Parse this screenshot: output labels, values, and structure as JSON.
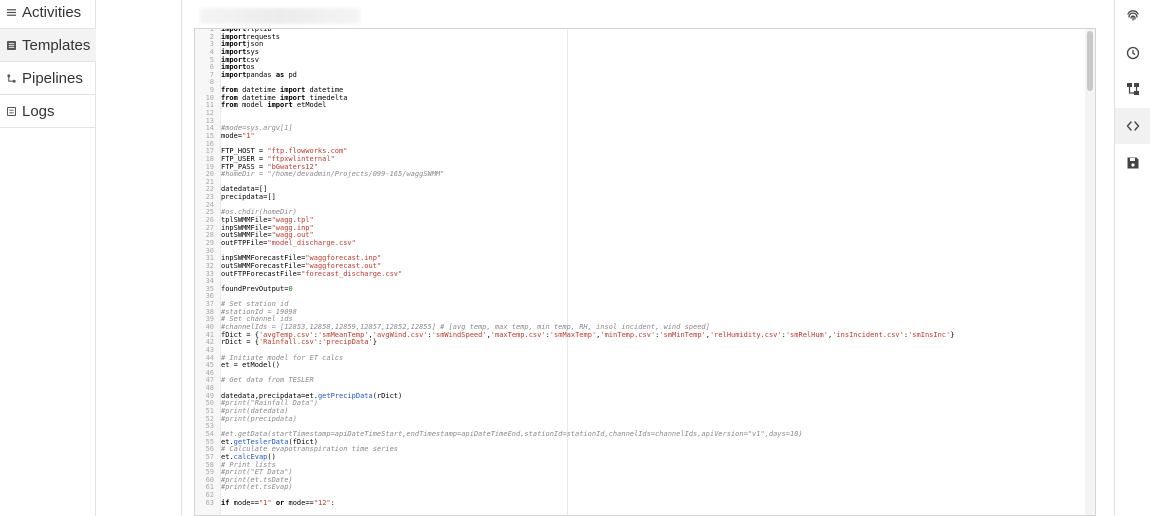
{
  "sidebar": {
    "items": [
      {
        "label": "Activities",
        "icon": "activities-icon"
      },
      {
        "label": "Templates",
        "icon": "templates-icon"
      },
      {
        "label": "Pipelines",
        "icon": "pipelines-icon"
      },
      {
        "label": "Logs",
        "icon": "logs-icon"
      }
    ]
  },
  "toolbar": {
    "tools": [
      "fingerprint-icon",
      "history-icon",
      "hierarchy-icon",
      "code-icon",
      "save-icon"
    ]
  },
  "editor": {
    "lines": [
      {
        "n": "1",
        "t": [
          [
            "kw",
            "import"
          ],
          [
            "",
            "ftplib"
          ]
        ]
      },
      {
        "n": "2",
        "t": [
          [
            "kw",
            "import"
          ],
          [
            "",
            "requests"
          ]
        ]
      },
      {
        "n": "3",
        "t": [
          [
            "kw",
            "import"
          ],
          [
            "",
            "json"
          ]
        ]
      },
      {
        "n": "4",
        "t": [
          [
            "kw",
            "import"
          ],
          [
            "",
            "sys"
          ]
        ]
      },
      {
        "n": "5",
        "t": [
          [
            "kw",
            "import"
          ],
          [
            "",
            "csv"
          ]
        ]
      },
      {
        "n": "6",
        "t": [
          [
            "kw",
            "import"
          ],
          [
            "",
            "os"
          ]
        ]
      },
      {
        "n": "7",
        "t": [
          [
            "kw",
            "import"
          ],
          [
            "",
            "pandas "
          ],
          [
            "kw",
            "as"
          ],
          [
            "",
            " pd"
          ]
        ]
      },
      {
        "n": "8",
        "t": []
      },
      {
        "n": "9",
        "t": [
          [
            "kw",
            "from"
          ],
          [
            "",
            " datetime "
          ],
          [
            "kw",
            "import"
          ],
          [
            "",
            " datetime"
          ]
        ]
      },
      {
        "n": "10",
        "t": [
          [
            "kw",
            "from"
          ],
          [
            "",
            " datetime "
          ],
          [
            "kw",
            "import"
          ],
          [
            "",
            " timedelta"
          ]
        ]
      },
      {
        "n": "11",
        "t": [
          [
            "kw",
            "from"
          ],
          [
            "",
            " model "
          ],
          [
            "kw",
            "import"
          ],
          [
            "",
            " etModel"
          ]
        ]
      },
      {
        "n": "12",
        "t": []
      },
      {
        "n": "13",
        "t": []
      },
      {
        "n": "14",
        "t": [
          [
            "cmt",
            "#mode=sys.argv[1]"
          ]
        ]
      },
      {
        "n": "15",
        "t": [
          [
            "",
            "mode="
          ],
          [
            "str",
            "\"1\""
          ]
        ]
      },
      {
        "n": "16",
        "t": []
      },
      {
        "n": "17",
        "t": [
          [
            "",
            "FTP_HOST = "
          ],
          [
            "str",
            "\"ftp.flowworks.com\""
          ]
        ]
      },
      {
        "n": "18",
        "t": [
          [
            "",
            "FTP_USER = "
          ],
          [
            "str",
            "\"ftpxwlinternal\""
          ]
        ]
      },
      {
        "n": "19",
        "t": [
          [
            "",
            "FTP_PASS = "
          ],
          [
            "str",
            "\"bGwaters12\""
          ]
        ]
      },
      {
        "n": "20",
        "t": [
          [
            "cmt",
            "#homeDir = \"/home/devadmin/Projects/099-165/waggSWMM\""
          ]
        ]
      },
      {
        "n": "21",
        "t": []
      },
      {
        "n": "22",
        "t": [
          [
            "",
            "datedata=[]"
          ]
        ]
      },
      {
        "n": "23",
        "t": [
          [
            "",
            "precipdata=[]"
          ]
        ]
      },
      {
        "n": "24",
        "t": []
      },
      {
        "n": "25",
        "t": [
          [
            "cmt",
            "#os.chdir(homeDir)"
          ]
        ]
      },
      {
        "n": "26",
        "t": [
          [
            "",
            "tplSWMMFile="
          ],
          [
            "str",
            "\"wagg.tpl\""
          ]
        ]
      },
      {
        "n": "27",
        "t": [
          [
            "",
            "inpSWMMFile="
          ],
          [
            "str",
            "\"wagg.inp\""
          ]
        ]
      },
      {
        "n": "28",
        "t": [
          [
            "",
            "outSWMMFile="
          ],
          [
            "str",
            "\"wagg.out\""
          ]
        ]
      },
      {
        "n": "29",
        "t": [
          [
            "",
            "outFTPFile="
          ],
          [
            "str",
            "\"model_discharge.csv\""
          ]
        ]
      },
      {
        "n": "30",
        "t": []
      },
      {
        "n": "31",
        "t": [
          [
            "",
            "inpSWMMForecastFile="
          ],
          [
            "str",
            "\"waggforecast.inp\""
          ]
        ]
      },
      {
        "n": "32",
        "t": [
          [
            "",
            "outSWMMForecastFile="
          ],
          [
            "str",
            "\"waggforecast.out\""
          ]
        ]
      },
      {
        "n": "33",
        "t": [
          [
            "",
            "outFTPForecastFile="
          ],
          [
            "str",
            "\"forecast_discharge.csv\""
          ]
        ]
      },
      {
        "n": "34",
        "t": []
      },
      {
        "n": "35",
        "t": [
          [
            "",
            "foundPrevOutput="
          ],
          [
            "nm",
            "0"
          ]
        ]
      },
      {
        "n": "36",
        "t": []
      },
      {
        "n": "37",
        "t": [
          [
            "cmt",
            "# Set station id"
          ]
        ]
      },
      {
        "n": "38",
        "t": [
          [
            "cmt",
            "#stationId = 19098"
          ]
        ]
      },
      {
        "n": "39",
        "t": [
          [
            "cmt",
            "# Set channel ids"
          ]
        ]
      },
      {
        "n": "40",
        "t": [
          [
            "cmt",
            "#channelIds = [12853,12858,12859,12857,12852,12855] # [avg temp, max temp, min temp, RH, insol incident, wind speed]"
          ]
        ]
      },
      {
        "n": "41",
        "t": [
          [
            "",
            "fDict = {"
          ],
          [
            "str",
            "'avgTemp.csv'"
          ],
          [
            "",
            ":"
          ],
          [
            "str",
            "'smMeanTemp'"
          ],
          [
            "",
            ","
          ],
          [
            "str",
            "'avgWind.csv'"
          ],
          [
            "",
            ":"
          ],
          [
            "str",
            "'smWindSpeed'"
          ],
          [
            "",
            ","
          ],
          [
            "str",
            "'maxTemp.csv'"
          ],
          [
            "",
            ":"
          ],
          [
            "str",
            "'smMaxTemp'"
          ],
          [
            "",
            ","
          ],
          [
            "str",
            "'minTemp.csv'"
          ],
          [
            "",
            ":"
          ],
          [
            "str",
            "'smMinTemp'"
          ],
          [
            "",
            ","
          ],
          [
            "str",
            "'relHumidity.csv'"
          ],
          [
            "",
            ":"
          ],
          [
            "str",
            "'smRelHum'"
          ],
          [
            "",
            ","
          ],
          [
            "str",
            "'insIncident.csv'"
          ],
          [
            "",
            ":"
          ],
          [
            "str",
            "'smInsInc'"
          ],
          [
            "",
            "}"
          ]
        ]
      },
      {
        "n": "42",
        "t": [
          [
            "",
            "rDict = {"
          ],
          [
            "str",
            "'Rainfall.csv'"
          ],
          [
            "",
            ":"
          ],
          [
            "str",
            "'precipData'"
          ],
          [
            "",
            "}"
          ]
        ]
      },
      {
        "n": "43",
        "t": []
      },
      {
        "n": "44",
        "t": [
          [
            "cmt",
            "# Initiate model for ET calcs"
          ]
        ]
      },
      {
        "n": "45",
        "t": [
          [
            "",
            "et = etModel()"
          ]
        ]
      },
      {
        "n": "46",
        "t": []
      },
      {
        "n": "47",
        "t": [
          [
            "cmt",
            "# Get data from TESLER"
          ]
        ]
      },
      {
        "n": "48",
        "t": []
      },
      {
        "n": "49",
        "t": [
          [
            "",
            "datedata,precipdata=et."
          ],
          [
            "fn",
            "getPrecipData"
          ],
          [
            "",
            "(rDict)"
          ]
        ]
      },
      {
        "n": "50",
        "t": [
          [
            "cmt",
            "#print(\"Rainfall Data\")"
          ]
        ]
      },
      {
        "n": "51",
        "t": [
          [
            "cmt",
            "#print(datedata)"
          ]
        ]
      },
      {
        "n": "52",
        "t": [
          [
            "cmt",
            "#print(precipdata)"
          ]
        ]
      },
      {
        "n": "53",
        "t": []
      },
      {
        "n": "54",
        "t": [
          [
            "cmt",
            "#et.getData(startTimestamp=apiDateTimeStart,endTimestamp=apiDateTimeEnd,stationId=stationId,channelIds=channelIds,apiVersion=\"v1\",days=10)"
          ]
        ]
      },
      {
        "n": "55",
        "t": [
          [
            "",
            "et."
          ],
          [
            "fn",
            "getTeslerData"
          ],
          [
            "",
            "(fDict)"
          ]
        ]
      },
      {
        "n": "56",
        "t": [
          [
            "cmt",
            "# Calculate evapotranspiration time series"
          ]
        ]
      },
      {
        "n": "57",
        "t": [
          [
            "",
            "et."
          ],
          [
            "fn",
            "calcEvap"
          ],
          [
            "",
            "()"
          ]
        ]
      },
      {
        "n": "58",
        "t": [
          [
            "cmt",
            "# Print lists"
          ]
        ]
      },
      {
        "n": "59",
        "t": [
          [
            "cmt",
            "#print(\"ET Data\")"
          ]
        ]
      },
      {
        "n": "60",
        "t": [
          [
            "cmt",
            "#print(et.tsDate)"
          ]
        ]
      },
      {
        "n": "61",
        "t": [
          [
            "cmt",
            "#print(et.tsEvap)"
          ]
        ]
      },
      {
        "n": "62",
        "t": []
      },
      {
        "n": "63",
        "t": [
          [
            "kw",
            "if"
          ],
          [
            "",
            " mode=="
          ],
          [
            "str",
            "\"1\""
          ],
          [
            "",
            " "
          ],
          [
            "kw",
            "or"
          ],
          [
            "",
            " mode=="
          ],
          [
            "str",
            "\"12\""
          ],
          [
            "",
            ":"
          ]
        ]
      }
    ]
  }
}
